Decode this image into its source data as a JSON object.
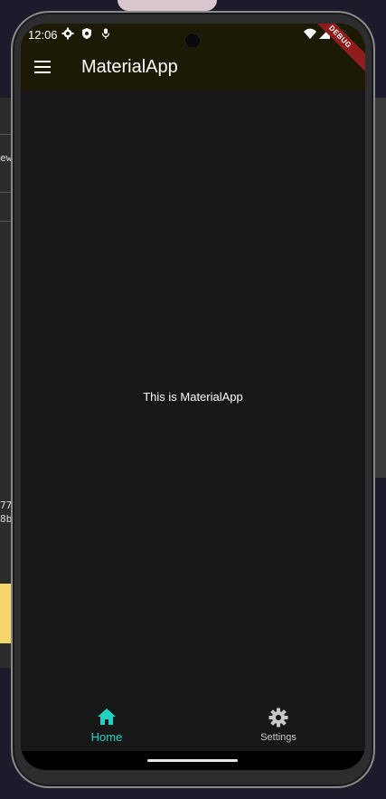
{
  "status_bar": {
    "time": "12:06",
    "icons": [
      "gear-icon",
      "shield-icon",
      "mic-icon",
      "wifi-icon",
      "signal-icon"
    ]
  },
  "app_bar": {
    "title": "MaterialApp",
    "menu_icon": "menu-icon",
    "background_color": "#1c1a05"
  },
  "debug_banner": {
    "label": "DEBUG",
    "color": "#8f1d1d"
  },
  "body": {
    "text": "This is MaterialApp"
  },
  "bottom_nav": {
    "items": [
      {
        "label": "Home",
        "icon": "home-icon",
        "selected": true,
        "color": "#1fd3c3"
      },
      {
        "label": "Settings",
        "icon": "settings-gear-icon",
        "selected": false,
        "color": "#c8c8c8"
      }
    ]
  },
  "background_text": {
    "line1": "ew",
    "line2": "77",
    "line3": "8b"
  }
}
